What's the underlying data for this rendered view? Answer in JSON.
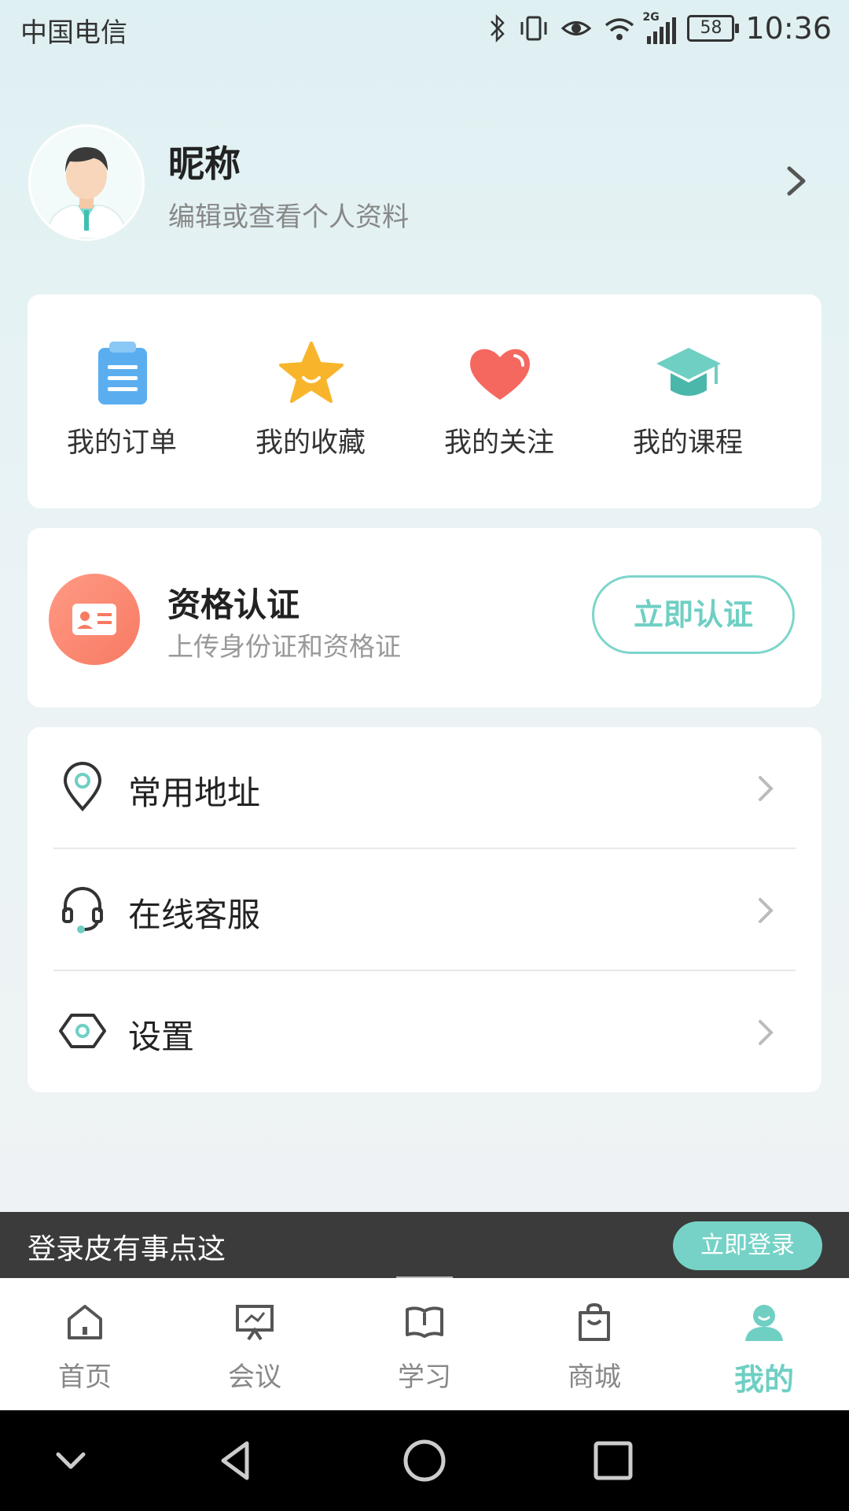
{
  "status_bar": {
    "carrier": "中国电信",
    "network": "2G",
    "battery": "58",
    "time": "10:36"
  },
  "profile": {
    "nickname": "昵称",
    "subtitle": "编辑或查看个人资料"
  },
  "quick_actions": [
    {
      "label": "我的订单",
      "icon": "clipboard-icon",
      "color": "#5aaef0"
    },
    {
      "label": "我的收藏",
      "icon": "star-icon",
      "color": "#f8b52c"
    },
    {
      "label": "我的关注",
      "icon": "heart-icon",
      "color": "#f5685f"
    },
    {
      "label": "我的课程",
      "icon": "graduation-cap-icon",
      "color": "#6fcfc3"
    }
  ],
  "certification": {
    "title": "资格认证",
    "subtitle": "上传身份证和资格证",
    "button": "立即认证"
  },
  "menu": [
    {
      "label": "常用地址",
      "icon": "location-pin-icon"
    },
    {
      "label": "在线客服",
      "icon": "headset-icon"
    },
    {
      "label": "设置",
      "icon": "settings-hexagon-icon"
    }
  ],
  "login_banner": {
    "text": "登录皮有事点这",
    "button": "立即登录"
  },
  "tabs": [
    {
      "label": "首页",
      "icon": "home-icon"
    },
    {
      "label": "会议",
      "icon": "presentation-icon"
    },
    {
      "label": "学习",
      "icon": "book-icon"
    },
    {
      "label": "商城",
      "icon": "shopping-bag-icon"
    },
    {
      "label": "我的",
      "icon": "profile-icon",
      "active": true
    }
  ],
  "colors": {
    "accent": "#6fcfc3",
    "cert_icon": "#f77a63",
    "login_bar": "#3b3b3b"
  }
}
